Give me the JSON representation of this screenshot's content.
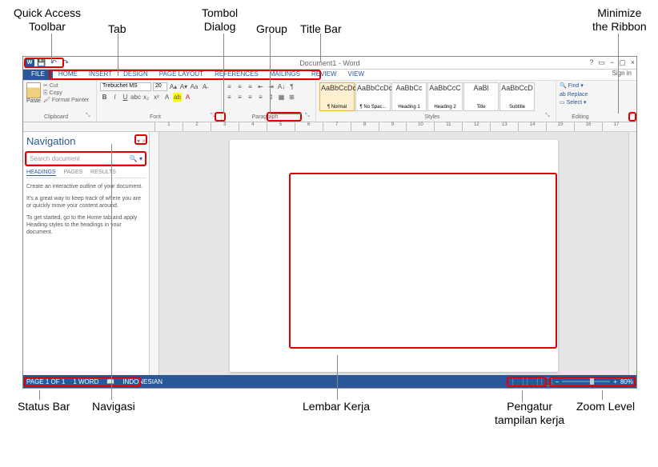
{
  "annotations": {
    "qat": "Quick Access\nToolbar",
    "tab": "Tab",
    "dialog": "Tombol\nDialog",
    "group": "Group",
    "titlebar": "Title Bar",
    "minimize": "Minimize\nthe Ribbon",
    "statusbar": "Status Bar",
    "navigasi": "Navigasi",
    "lembar": "Lembar Kerja",
    "pengatur": "Pengatur\ntampilan kerja",
    "zoom": "Zoom Level"
  },
  "title": "Document1 - Word",
  "tabs": [
    "FILE",
    "HOME",
    "INSERT",
    "DESIGN",
    "PAGE LAYOUT",
    "REFERENCES",
    "MAILINGS",
    "REVIEW",
    "VIEW"
  ],
  "signin": "Sign in",
  "clipboard": {
    "cut": "Cut",
    "copy": "Copy",
    "fp": "Format Painter",
    "paste": "Paste",
    "label": "Clipboard"
  },
  "font": {
    "name": "Trebuchet MS",
    "size": "20",
    "label": "Font"
  },
  "paragraph_label": "Paragraph",
  "styles": [
    {
      "sample": "AaBbCcDc",
      "name": "¶ Normal"
    },
    {
      "sample": "AaBbCcDc",
      "name": "¶ No Spac..."
    },
    {
      "sample": "AaBbCc",
      "name": "Heading 1"
    },
    {
      "sample": "AaBbCcC",
      "name": "Heading 2"
    },
    {
      "sample": "AaBl",
      "name": "Title"
    },
    {
      "sample": "AaBbCcD",
      "name": "Subtitle"
    }
  ],
  "styles_label": "Styles",
  "editing": {
    "find": "Find",
    "replace": "Replace",
    "select": "Select",
    "label": "Editing"
  },
  "nav": {
    "title": "Navigation",
    "search_placeholder": "Search document",
    "tabs": [
      "HEADINGS",
      "PAGES",
      "RESULTS"
    ],
    "text1": "Create an interactive outline of your document.",
    "text2": "It's a great way to keep track of where you are or quickly move your content around.",
    "text3": "To get started, go to the Home tab and apply Heading styles to the headings in your document."
  },
  "status": {
    "page": "PAGE 1 OF 1",
    "words": "1 WORD",
    "lang": "INDONESIAN",
    "zoom": "80%"
  },
  "ruler_marks": [
    "1",
    "2",
    "3",
    "4",
    "5",
    "6",
    "7",
    "8",
    "9",
    "10",
    "11",
    "12",
    "13",
    "14",
    "15",
    "16",
    "17"
  ]
}
